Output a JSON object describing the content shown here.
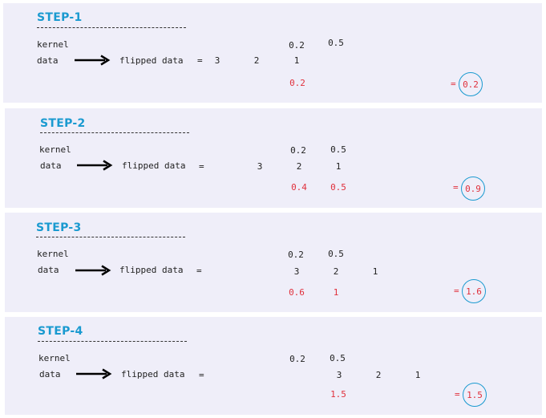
{
  "labels": {
    "kernel": "kernel",
    "data": "data",
    "flipped": "flipped data",
    "eq": "=",
    "rule": "---------------------------"
  },
  "steps": [
    {
      "title": "STEP-1",
      "kernel": [
        "0.2",
        "0.5"
      ],
      "flipped": [
        "3",
        "2",
        "1"
      ],
      "products": [
        "0.2"
      ],
      "result": "0.2"
    },
    {
      "title": "STEP-2",
      "kernel": [
        "0.2",
        "0.5"
      ],
      "flipped": [
        "3",
        "2",
        "1"
      ],
      "products": [
        "0.4",
        "0.5"
      ],
      "result": "0.9"
    },
    {
      "title": "STEP-3",
      "kernel": [
        "0.2",
        "0.5"
      ],
      "flipped": [
        "3",
        "2",
        "1"
      ],
      "products": [
        "0.6",
        "1"
      ],
      "result": "1.6"
    },
    {
      "title": "STEP-4",
      "kernel": [
        "0.2",
        "0.5"
      ],
      "flipped": [
        "3",
        "2",
        "1"
      ],
      "products": [
        "1.5"
      ],
      "result": "1.5"
    }
  ]
}
